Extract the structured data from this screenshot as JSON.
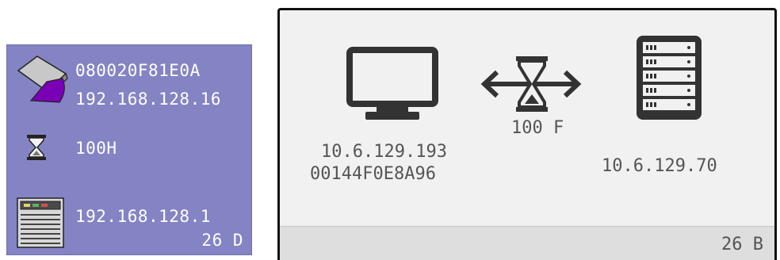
{
  "old_panel": {
    "mac_address": "080020F81E0A",
    "ip_address": "192.168.128.16",
    "link_status": "100H",
    "switch_ip": "192.168.128.1",
    "port": "26 D",
    "icons": [
      "workstation-icon",
      "hourglass-icon",
      "switch-icon"
    ],
    "background_color": "#8484c4"
  },
  "new_panel": {
    "host_ip": "10.6.129.193",
    "host_mac": "00144F0E8A96",
    "link_status": "100 F",
    "switch_ip": "10.6.129.70",
    "port": "26 B",
    "icons": [
      "monitor-icon",
      "bidirectional-arrow-icon",
      "hourglass-icon",
      "server-rack-icon"
    ],
    "background_color": "#f1f1f1"
  }
}
